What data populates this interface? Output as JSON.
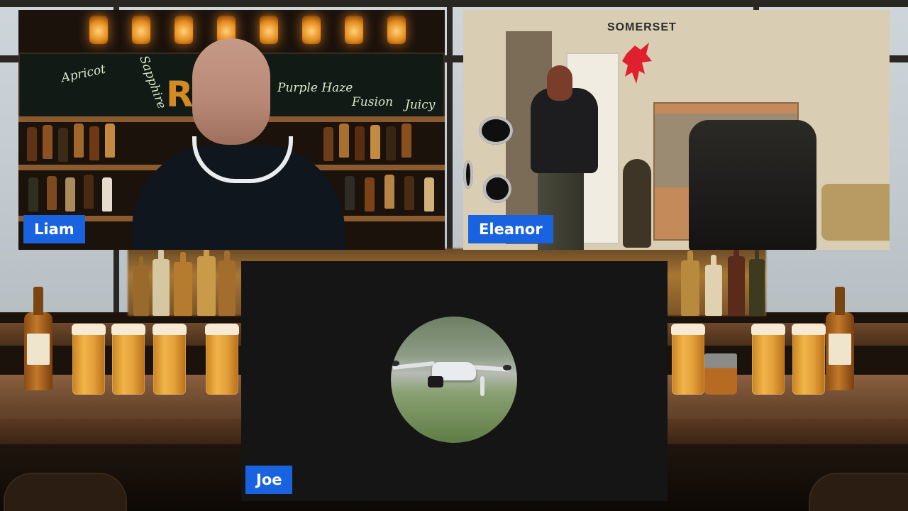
{
  "participants": [
    {
      "name": "Liam"
    },
    {
      "name": "Eleanor"
    },
    {
      "name": "Joe"
    }
  ],
  "liam_feed": {
    "chalkboard_words": [
      "Apricot",
      "Sapphire",
      "Purple Haze",
      "Fusion",
      "Juicy"
    ],
    "sign_letters": "R"
  },
  "eleanor_feed": {
    "wall_text": "SOMERSET"
  },
  "joe_feed": {
    "avatar_icon": "drone-photo-avatar"
  },
  "colors": {
    "name_tag_bg": "#1a63e0",
    "name_tag_text": "#ffffff",
    "empty_tile_bg": "#151515"
  }
}
